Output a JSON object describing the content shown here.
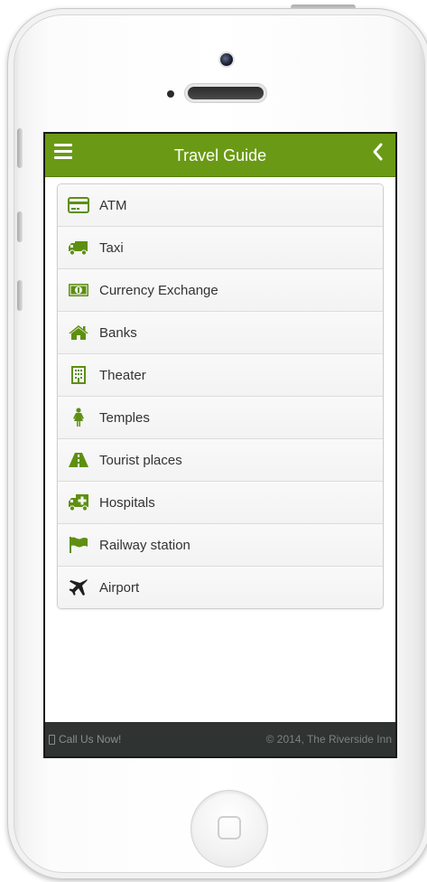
{
  "header": {
    "title": "Travel Guide",
    "menu_icon": "hamburger-menu-icon",
    "back_icon": "chevron-left-icon"
  },
  "list": {
    "items": [
      {
        "label": "ATM",
        "icon": "credit-card-icon"
      },
      {
        "label": "Taxi",
        "icon": "truck-icon"
      },
      {
        "label": "Currency Exchange",
        "icon": "money-icon"
      },
      {
        "label": "Banks",
        "icon": "home-icon"
      },
      {
        "label": "Theater",
        "icon": "building-icon"
      },
      {
        "label": "Temples",
        "icon": "female-icon"
      },
      {
        "label": "Tourist places",
        "icon": "road-icon"
      },
      {
        "label": "Hospitals",
        "icon": "ambulance-icon"
      },
      {
        "label": "Railway station",
        "icon": "flag-icon"
      },
      {
        "label": "Airport",
        "icon": "plane-icon"
      }
    ]
  },
  "footer": {
    "call_label": "Call Us Now!",
    "copyright": "© 2014, The Riverside Inn"
  },
  "colors": {
    "header_bg": "#6a9a15",
    "icon_green": "#5e8f12",
    "footer_bg": "#2f3331",
    "list_bg": "#f6f6f6"
  }
}
